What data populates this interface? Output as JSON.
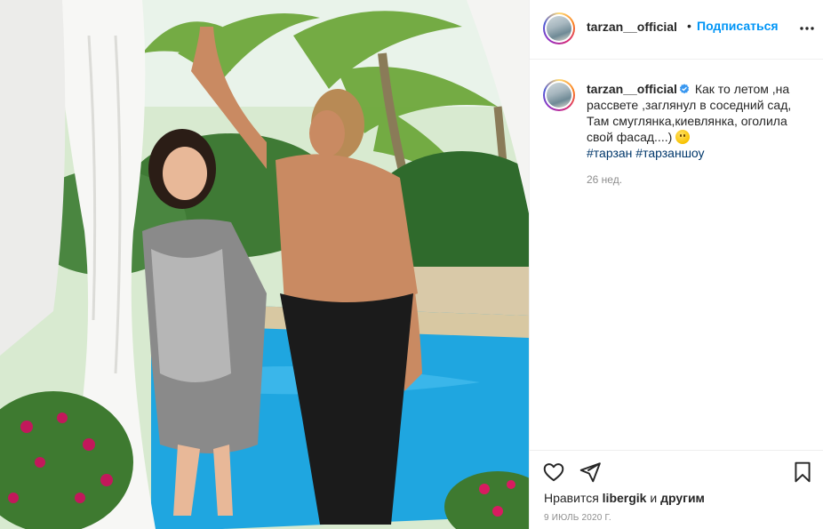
{
  "header": {
    "username": "tarzan__official",
    "separator": "•",
    "follow_label": "Подписаться",
    "more_icon": "more-horizontal-icon"
  },
  "caption": {
    "username": "tarzan__official",
    "verified_icon": "verified-badge-icon",
    "text": "Как то летом ,на рассвете ,заглянул в соседний сад, Там смуглянка,киевлянка, оголила свой фасад....)",
    "emoji": "smiling-face-emoji",
    "hashtag_1": "#тарзан",
    "hashtag_2": "#тарзаншоу",
    "time_ago": "26 нед."
  },
  "actions": {
    "like_icon": "heart-icon",
    "share_icon": "paper-plane-icon",
    "save_icon": "bookmark-icon",
    "likes_prefix": "Нравится",
    "likes_user": "libergik",
    "likes_suffix": "и",
    "likes_others": "другим",
    "date": "9 ИЮЛЬ 2020 Г."
  },
  "photo": {
    "description_alt": "post-photo"
  },
  "colors": {
    "accent": "#0095f6",
    "hashtag": "#00376b",
    "muted": "#8e8e8e",
    "border": "#efefef"
  }
}
